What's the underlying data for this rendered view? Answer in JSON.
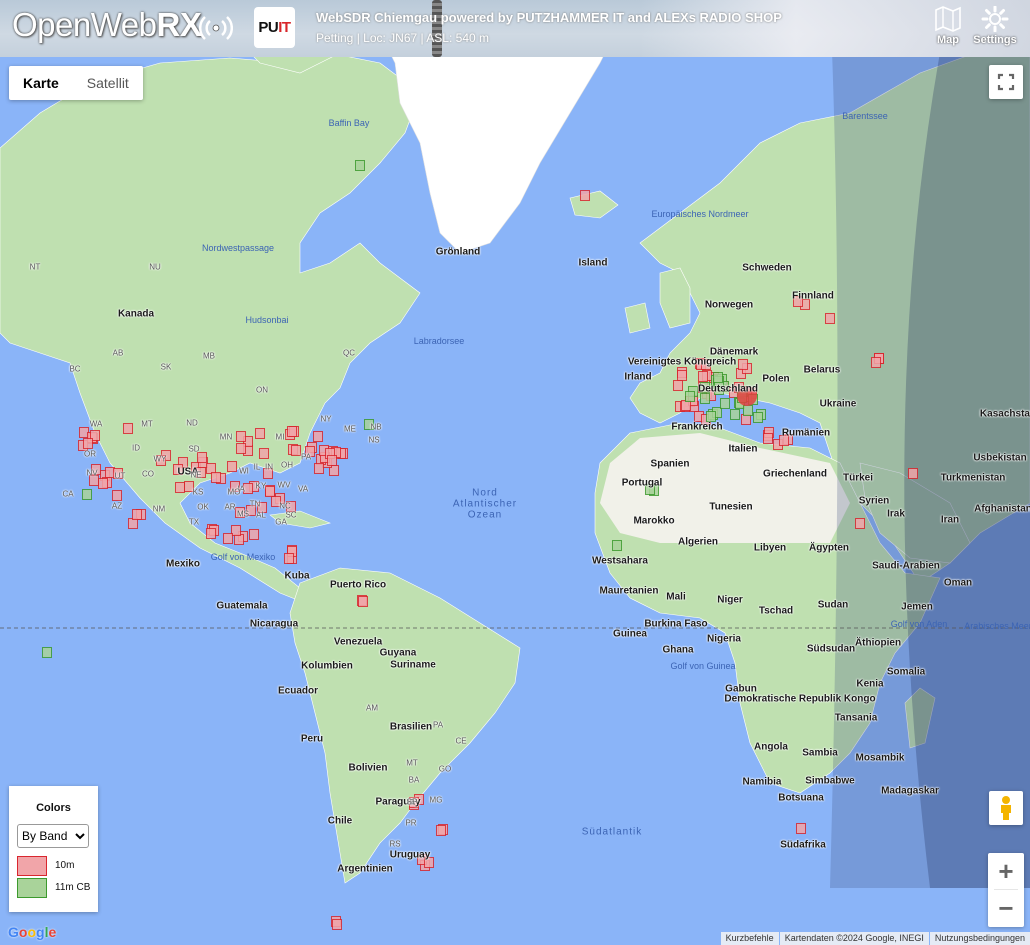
{
  "header": {
    "logo_open": "Open",
    "logo_web": "Web",
    "logo_rx": "RX",
    "partner_logo_black": "PU",
    "partner_logo_red": "IT",
    "receiver_title": "WebSDR Chiemgau powered by PUTZHAMMER IT and ALEXs RADIO SHOP",
    "receiver_details": "Petting | Loc: JN67 | ASL: 540 m",
    "map_button_label": "Map",
    "settings_button_label": "Settings"
  },
  "map": {
    "maptype_tabs": [
      {
        "label": "Karte",
        "active": true
      },
      {
        "label": "Satellit",
        "active": false
      }
    ],
    "legend": {
      "title": "Colors",
      "select_value": "By Band",
      "entries": [
        {
          "label": "10m",
          "fill": "#f1a5a9",
          "stroke": "#d9262e"
        },
        {
          "label": "11m CB",
          "fill": "#a9d39a",
          "stroke": "#3c9a2d"
        }
      ]
    },
    "labels": {
      "countries": [
        "Kanada",
        "USA",
        "Mexiko",
        "Kuba",
        "Puerto Rico",
        "Guatemala",
        "Nicaragua",
        "Venezuela",
        "Guyana",
        "Suriname",
        "Kolumbien",
        "Ecuador",
        "Peru",
        "Brasilien",
        "Bolivien",
        "Paraguay",
        "Chile",
        "Uruguay",
        "Argentinien",
        "Grönland",
        "Island",
        "Schweden",
        "Finnland",
        "Norwegen",
        "Dänemark",
        "Vereinigtes Königreich",
        "Irland",
        "Deutschland",
        "Polen",
        "Belarus",
        "Ukraine",
        "Frankreich",
        "Rumänien",
        "Spanien",
        "Portugal",
        "Italien",
        "Griechenland",
        "Türkei",
        "Kasachstan",
        "Usbekistan",
        "Turkmenistan",
        "Syrien",
        "Irak",
        "Iran",
        "Afghanistan",
        "Tunesien",
        "Marokko",
        "Algerien",
        "Libyen",
        "Ägypten",
        "Westsahara",
        "Mauretanien",
        "Mali",
        "Niger",
        "Tschad",
        "Sudan",
        "Saudi-Arabien",
        "Oman",
        "Jemen",
        "Burkina Faso",
        "Guinea",
        "Ghana",
        "Nigeria",
        "Äthiopien",
        "Südsudan",
        "Somalia",
        "Kenia",
        "Gabun",
        "Demokratische Republik Kongo",
        "Tansania",
        "Angola",
        "Sambia",
        "Mosambik",
        "Namibia",
        "Simbabwe",
        "Botsuana",
        "Madagaskar",
        "Südafrika"
      ],
      "waters": [
        "Baffin Bay",
        "Nordwestpassage",
        "Hudsonbai",
        "Labradorsee",
        "Europäisches Nordmeer",
        "Barentssee",
        "Golf von Mexiko",
        "Golf von Guinea",
        "Golf von Aden",
        "Arabisches Meer"
      ],
      "oceans": [
        "Nord Atlantischer Ozean",
        "Südatlantik"
      ],
      "states": [
        "BC",
        "AB",
        "SK",
        "MB",
        "ON",
        "QC",
        "NB",
        "NS",
        "WA",
        "MT",
        "ND",
        "MN",
        "OR",
        "ID",
        "WY",
        "SD",
        "WI",
        "MI",
        "NY",
        "ME",
        "NV",
        "UT",
        "CO",
        "NE",
        "IA",
        "IL",
        "IN",
        "OH",
        "PA",
        "CA",
        "AZ",
        "NM",
        "KS",
        "MO",
        "KY",
        "WV",
        "VA",
        "OK",
        "AR",
        "TN",
        "NC",
        "TX",
        "MS",
        "AL",
        "GA",
        "SC",
        "NT",
        "NU",
        "AM",
        "PA",
        "CE",
        "MT",
        "GO",
        "BA",
        "MG",
        "SP",
        "PR",
        "RS"
      ]
    },
    "attribution": {
      "google": "Google",
      "shortcuts": "Kurzbefehle",
      "map_data": "Kartendaten ©2024 Google, INEGI",
      "terms": "Nutzungsbedingungen"
    },
    "marker_counts": {
      "10m": 170,
      "11m CB": 30
    }
  }
}
